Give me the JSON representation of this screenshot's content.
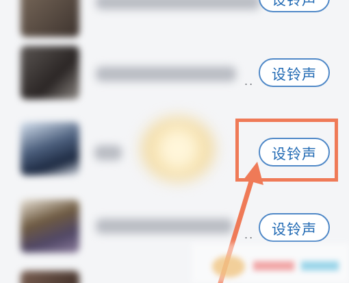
{
  "list": {
    "rows": [
      {
        "button_label": "设铃声"
      },
      {
        "button_label": "设铃声"
      },
      {
        "button_label": "设铃声"
      },
      {
        "button_label": "设铃声"
      }
    ],
    "dots": "..",
    "partial_top_button_label": "设铃声"
  },
  "icons": {
    "annotation_arrow": "arrow-icon",
    "avatar_placeholder": "avatar-icon"
  },
  "colors": {
    "button_border": "#4f88c7",
    "button_text": "#236bb4",
    "highlight": "#ef7a57",
    "background": "#f4f5f7"
  }
}
